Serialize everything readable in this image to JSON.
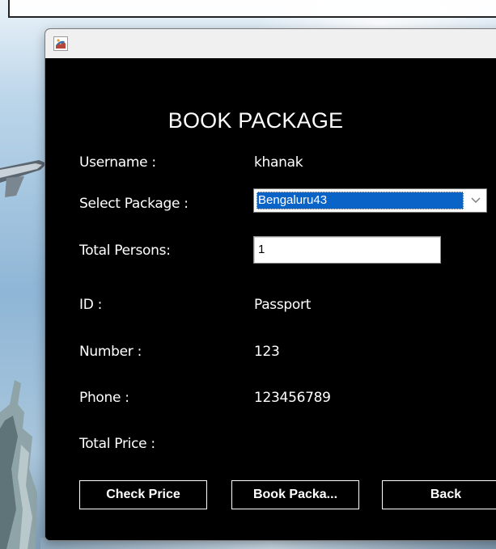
{
  "window": {
    "title": ""
  },
  "form": {
    "heading": "BOOK PACKAGE",
    "username_label": "Username :",
    "username_value": "khanak",
    "package_label": "Select Package :",
    "package_selected": "Bengaluru43",
    "persons_label": "Total Persons:",
    "persons_value": "1",
    "id_label": "ID :",
    "id_value": "Passport",
    "number_label": "Number :",
    "number_value": "123",
    "phone_label": "Phone :",
    "phone_value": "123456789",
    "price_label": "Total Price :",
    "price_value": ""
  },
  "buttons": {
    "check_price": "Check Price",
    "book_package": "Book Packa...",
    "back": "Back"
  },
  "icons": {
    "app": "java-app-icon",
    "dropdown": "chevron-down-icon"
  },
  "colors": {
    "panel_background": "#000000",
    "text": "#ffffff",
    "selection": "#0a64c8"
  }
}
